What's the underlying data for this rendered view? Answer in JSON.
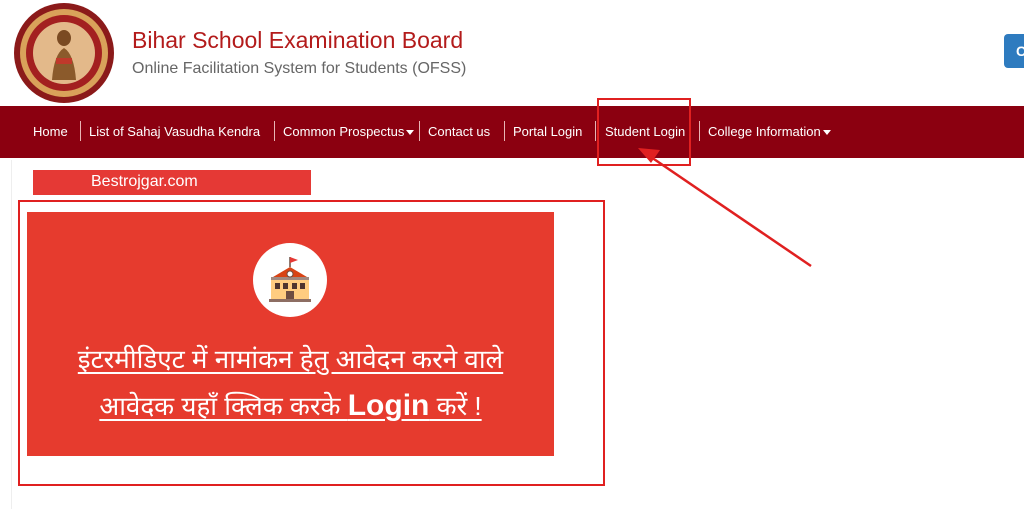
{
  "header": {
    "title": "Bihar School Examination Board",
    "subtitle": "Online Facilitation System for Students (OFSS)",
    "right_button_label": "C"
  },
  "nav": {
    "items": [
      {
        "label": "Home"
      },
      {
        "label": "List of Sahaj Vasudha Kendra"
      },
      {
        "label": "Common Prospectus",
        "dropdown": true
      },
      {
        "label": "Contact us"
      },
      {
        "label": "Portal Login"
      },
      {
        "label": "Student Login"
      },
      {
        "label": "College Information",
        "dropdown": true
      }
    ]
  },
  "watermark": {
    "text": "Bestrojgar.com"
  },
  "card": {
    "icon": "school-building-icon",
    "line1": "इंटरमीडिएट में नामांकन हेतु आवेदन करने वाले",
    "line2_prefix": "आवेदक यहाँ क्लिक करके ",
    "line2_login": "Login",
    "line2_suffix": " करें !"
  },
  "colors": {
    "brand_red": "#b31b1b",
    "nav_bg": "#8b0010",
    "card_bg": "#e63b2e",
    "annotation": "#e02020"
  }
}
